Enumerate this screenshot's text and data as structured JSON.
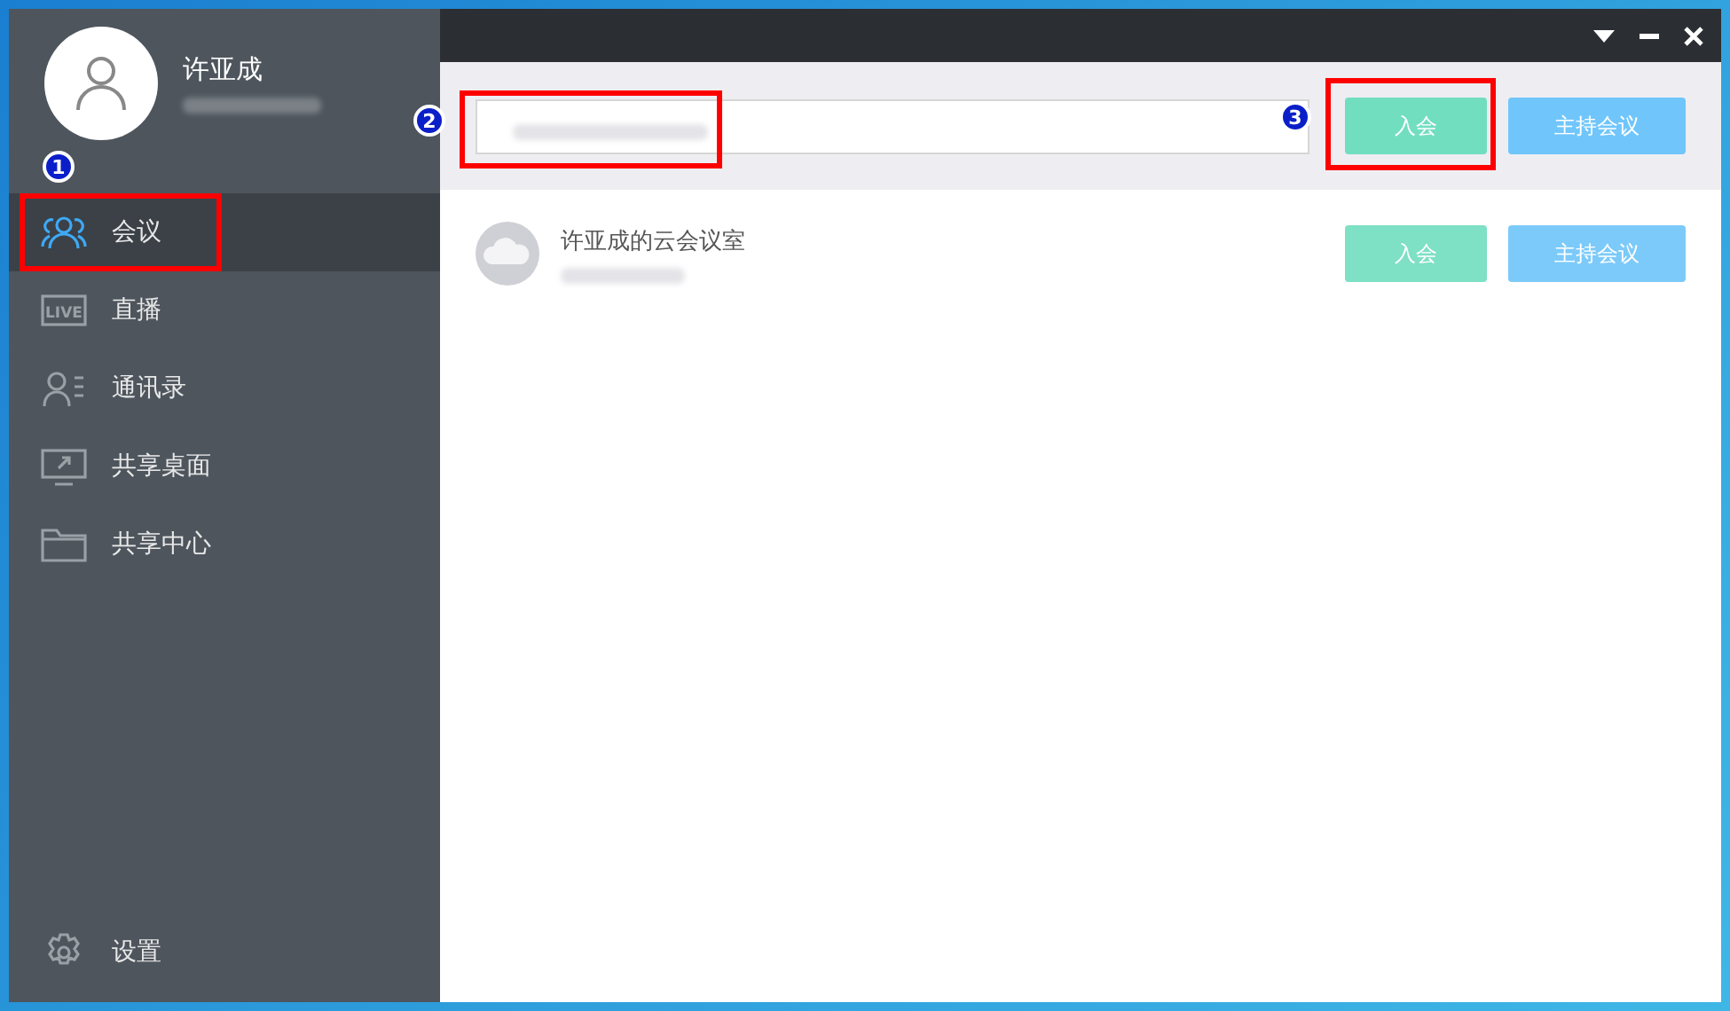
{
  "user": {
    "name": "许亚成"
  },
  "nav": [
    {
      "label": "会议",
      "kind": "people",
      "selected": true
    },
    {
      "label": "直播",
      "kind": "badge",
      "icon_text": "LIVE",
      "selected": false
    },
    {
      "label": "通讯录",
      "kind": "contacts",
      "selected": false
    },
    {
      "label": "共享桌面",
      "kind": "screen",
      "selected": false
    },
    {
      "label": "共享中心",
      "kind": "folder",
      "selected": false
    }
  ],
  "settings": {
    "label": "设置"
  },
  "toolbar": {
    "join_button": "入会",
    "host_button": "主持会议"
  },
  "rooms": [
    {
      "name": "许亚成的云会议室",
      "join_button": "入会",
      "host_button": "主持会议"
    }
  ],
  "annotations": [
    {
      "number": "1"
    },
    {
      "number": "2"
    },
    {
      "number": "3"
    }
  ]
}
